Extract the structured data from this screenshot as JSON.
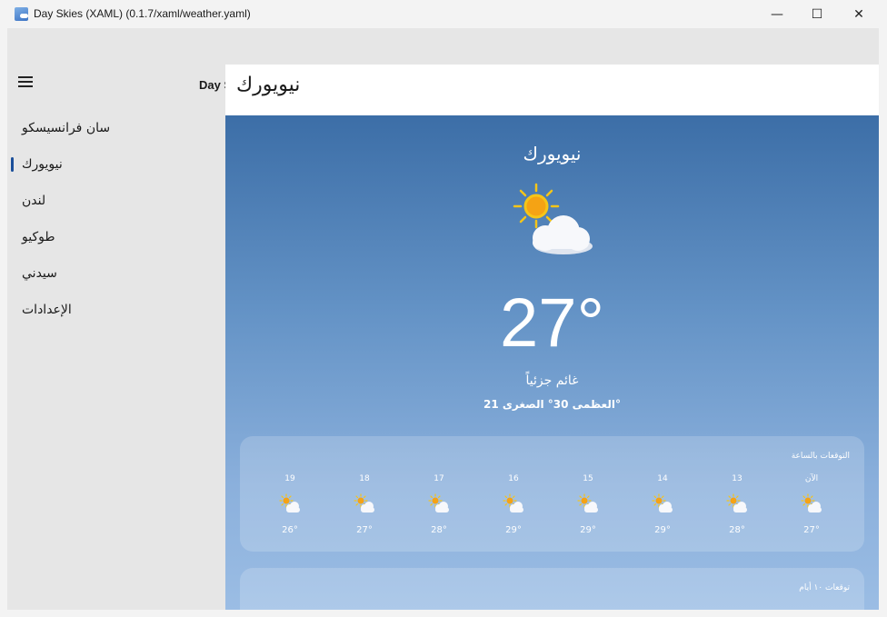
{
  "window": {
    "title": "Day Skies (XAML) (0.1.7/xaml/weather.yaml)",
    "minimize_glyph": "—",
    "maximize_glyph": "☐",
    "close_glyph": "✕"
  },
  "nav": {
    "items": [
      {
        "label": "سان فرانسيسكو"
      },
      {
        "label": "نيويورك"
      },
      {
        "label": "لندن"
      },
      {
        "label": "طوكيو"
      },
      {
        "label": "سيدني"
      },
      {
        "label": "الإعدادات"
      }
    ],
    "selected_index": 1,
    "behind_title": "Day S"
  },
  "page": {
    "title": "نيويورك"
  },
  "weather": {
    "city": "نيويورك",
    "temperature": "27°",
    "condition": "غائم جزئياً",
    "hi_lo": "العظمى 30° الصغرى 21°",
    "icon": "partly-cloudy-icon"
  },
  "hourly": {
    "title": "التوقعات بالساعة",
    "items": [
      {
        "label": "19",
        "temp": "26°",
        "icon": "partly-cloudy-icon"
      },
      {
        "label": "18",
        "temp": "27°",
        "icon": "partly-cloudy-icon"
      },
      {
        "label": "17",
        "temp": "28°",
        "icon": "partly-cloudy-icon"
      },
      {
        "label": "16",
        "temp": "29°",
        "icon": "partly-cloudy-icon"
      },
      {
        "label": "15",
        "temp": "29°",
        "icon": "partly-cloudy-icon"
      },
      {
        "label": "14",
        "temp": "29°",
        "icon": "partly-cloudy-icon"
      },
      {
        "label": "13",
        "temp": "28°",
        "icon": "partly-cloudy-icon"
      },
      {
        "label": "الآن",
        "temp": "27°",
        "icon": "partly-cloudy-icon"
      }
    ]
  },
  "daily": {
    "title": "توقعات ١٠ أيام"
  },
  "colors": {
    "sky_top": "#3c6ea7",
    "sky_bottom": "#9bbde4",
    "sun": "#f5c518",
    "accent": "#1b4f9a"
  }
}
